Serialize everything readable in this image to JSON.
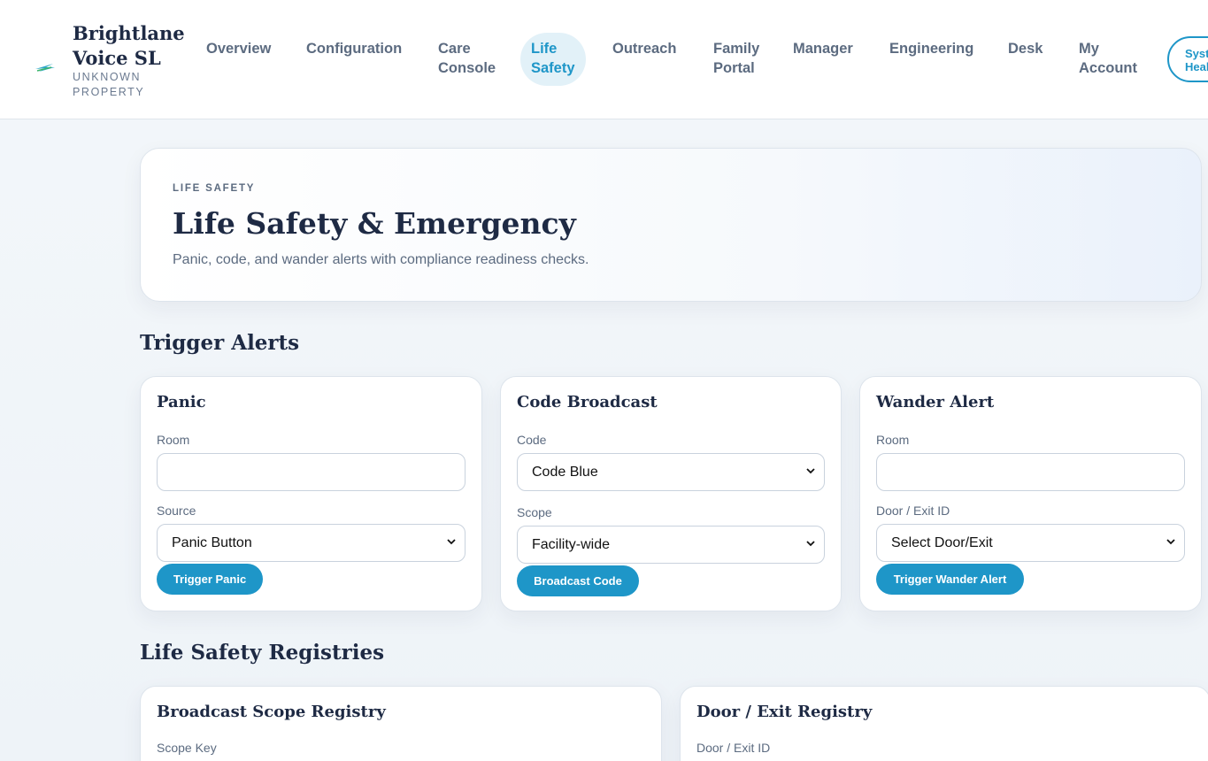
{
  "brand": {
    "name": "Brightlane Voice SL",
    "property": "UNKNOWN PROPERTY"
  },
  "nav": {
    "overview": "Overview",
    "configuration": "Configuration",
    "care_console": "Care Console",
    "life_safety": "Life Safety",
    "outreach": "Outreach",
    "family_portal": "Family Portal",
    "manager": "Manager",
    "engineering": "Engineering",
    "desk": "Desk",
    "my_account": "My Account",
    "system_health": "System Health"
  },
  "hero": {
    "eyebrow": "LIFE SAFETY",
    "title": "Life Safety & Emergency",
    "subtitle": "Panic, code, and wander alerts with compliance readiness checks."
  },
  "sections": {
    "trigger_alerts": "Trigger Alerts",
    "registries": "Life Safety Registries"
  },
  "panic": {
    "title": "Panic",
    "room_label": "Room",
    "room_value": "",
    "source_label": "Source",
    "source_value": "Panic Button",
    "button": "Trigger Panic"
  },
  "code_broadcast": {
    "title": "Code Broadcast",
    "code_label": "Code",
    "code_value": "Code Blue",
    "scope_label": "Scope",
    "scope_value": "Facility-wide",
    "button": "Broadcast Code"
  },
  "wander": {
    "title": "Wander Alert",
    "room_label": "Room",
    "room_value": "",
    "door_label": "Door / Exit ID",
    "door_value": "Select Door/Exit",
    "button": "Trigger Wander Alert"
  },
  "scope_registry": {
    "title": "Broadcast Scope Registry",
    "field_label": "Scope Key"
  },
  "door_registry": {
    "title": "Door / Exit Registry",
    "field_label": "Door / Exit ID"
  },
  "colors": {
    "accent": "#1e96c8",
    "navy": "#1e2a44",
    "muted": "#5c6b80"
  }
}
